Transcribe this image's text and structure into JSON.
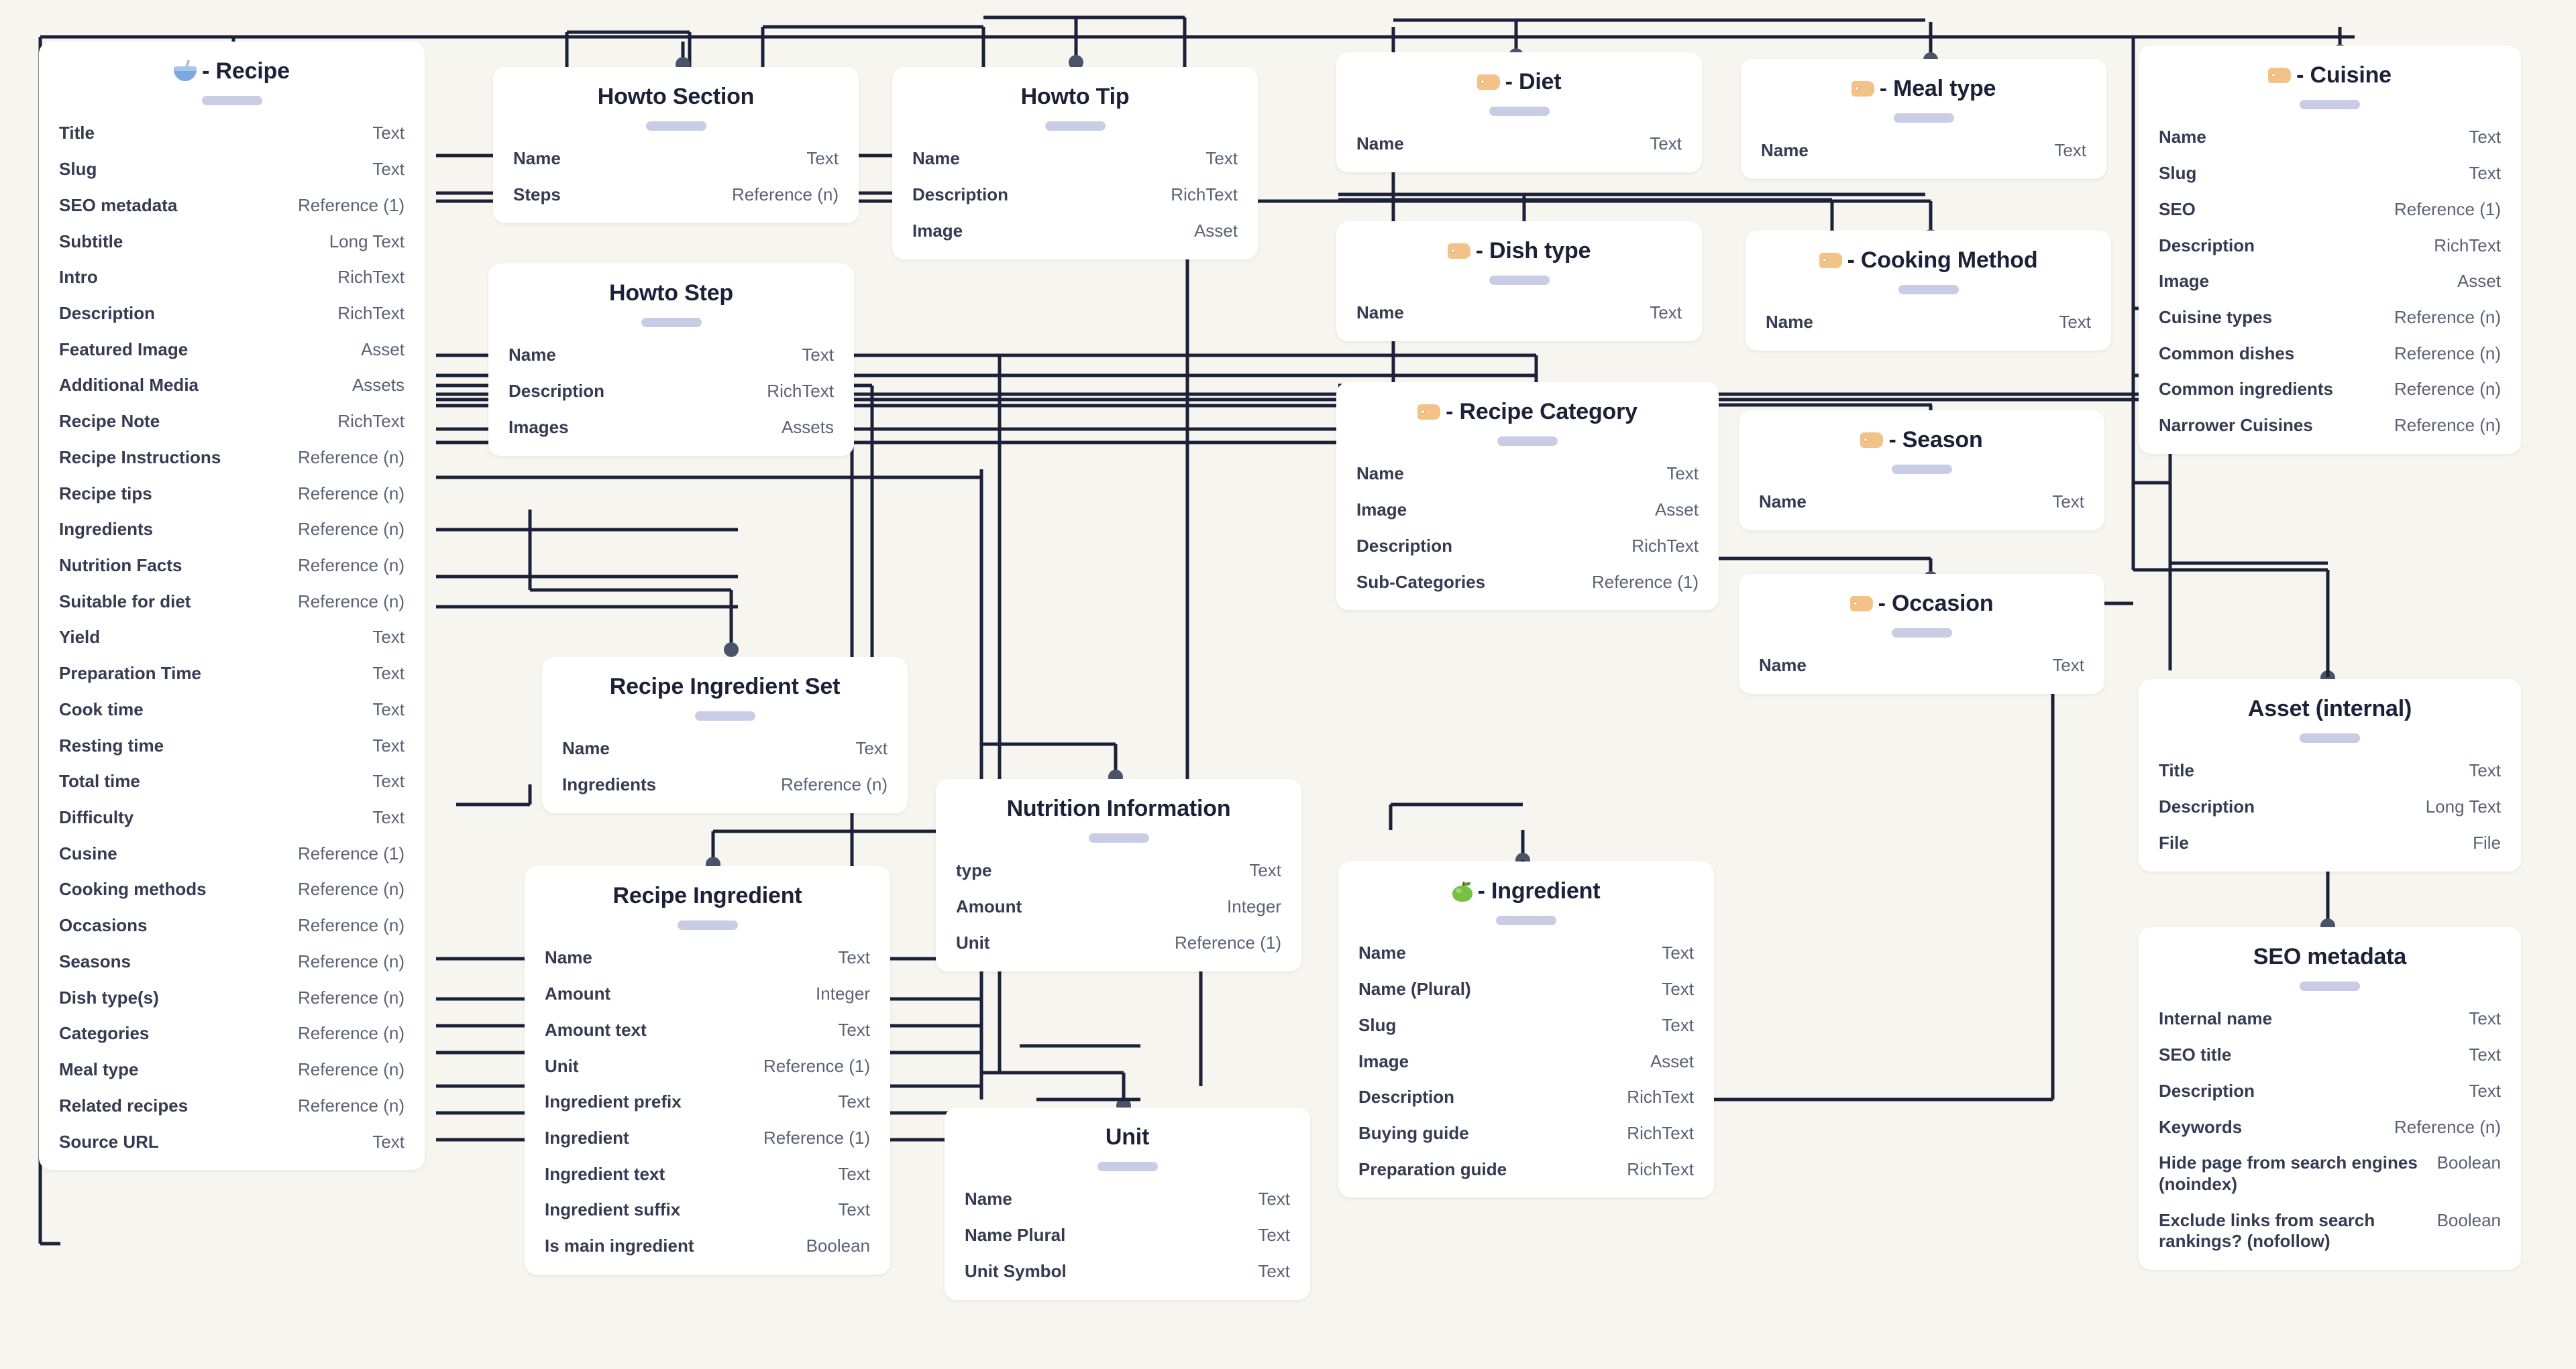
{
  "diagram": {
    "title": "Recipe content model",
    "background_color": "#f7f5ef",
    "card_color": "#ffffff",
    "line_color": "#1b2138",
    "pill_color": "#c9cce5",
    "tag_color": "#f2c288"
  },
  "entities": [
    {
      "id": "recipe",
      "emoji": "bowl-with-spoon",
      "title": "- Recipe",
      "fields": [
        {
          "name": "Title",
          "type": "Text"
        },
        {
          "name": "Slug",
          "type": "Text"
        },
        {
          "name": "SEO metadata",
          "type": "Reference (1)"
        },
        {
          "name": "Subtitle",
          "type": "Long Text"
        },
        {
          "name": "Intro",
          "type": "RichText"
        },
        {
          "name": "Description",
          "type": "RichText"
        },
        {
          "name": "Featured Image",
          "type": "Asset"
        },
        {
          "name": "Additional Media",
          "type": "Assets"
        },
        {
          "name": "Recipe Note",
          "type": "RichText"
        },
        {
          "name": "Recipe Instructions",
          "type": "Reference (n)"
        },
        {
          "name": "Recipe tips",
          "type": "Reference (n)"
        },
        {
          "name": "Ingredients",
          "type": "Reference (n)"
        },
        {
          "name": "Nutrition Facts",
          "type": "Reference (n)"
        },
        {
          "name": "Suitable for diet",
          "type": "Reference (n)"
        },
        {
          "name": "Yield",
          "type": "Text"
        },
        {
          "name": "Preparation Time",
          "type": "Text"
        },
        {
          "name": "Cook time",
          "type": "Text"
        },
        {
          "name": "Resting time",
          "type": "Text"
        },
        {
          "name": "Total time",
          "type": "Text"
        },
        {
          "name": "Difficulty",
          "type": "Text"
        },
        {
          "name": "Cusine",
          "type": "Reference (1)"
        },
        {
          "name": "Cooking methods",
          "type": "Reference (n)"
        },
        {
          "name": "Occasions",
          "type": "Reference (n)"
        },
        {
          "name": "Seasons",
          "type": "Reference (n)"
        },
        {
          "name": "Dish type(s)",
          "type": "Reference (n)"
        },
        {
          "name": "Categories",
          "type": "Reference (n)"
        },
        {
          "name": "Meal type",
          "type": "Reference (n)"
        },
        {
          "name": "Related recipes",
          "type": "Reference (n)"
        },
        {
          "name": "Source URL",
          "type": "Text"
        }
      ]
    },
    {
      "id": "howto-section",
      "emoji": "",
      "title": "Howto Section",
      "fields": [
        {
          "name": "Name",
          "type": "Text"
        },
        {
          "name": "Steps",
          "type": "Reference (n)"
        }
      ]
    },
    {
      "id": "howto-step",
      "emoji": "",
      "title": "Howto Step",
      "fields": [
        {
          "name": "Name",
          "type": "Text"
        },
        {
          "name": "Description",
          "type": "RichText"
        },
        {
          "name": "Images",
          "type": "Assets"
        }
      ]
    },
    {
      "id": "howto-tip",
      "emoji": "",
      "title": "Howto Tip",
      "fields": [
        {
          "name": "Name",
          "type": "Text"
        },
        {
          "name": "Description",
          "type": "RichText"
        },
        {
          "name": "Image",
          "type": "Asset"
        }
      ]
    },
    {
      "id": "diet",
      "emoji": "tag",
      "title": "- Diet",
      "fields": [
        {
          "name": "Name",
          "type": "Text"
        }
      ]
    },
    {
      "id": "meal-type",
      "emoji": "tag",
      "title": "- Meal type",
      "fields": [
        {
          "name": "Name",
          "type": "Text"
        }
      ]
    },
    {
      "id": "cuisine",
      "emoji": "tag",
      "title": "- Cuisine",
      "fields": [
        {
          "name": "Name",
          "type": "Text"
        },
        {
          "name": "Slug",
          "type": "Text"
        },
        {
          "name": "SEO",
          "type": "Reference (1)"
        },
        {
          "name": "Description",
          "type": "RichText"
        },
        {
          "name": "Image",
          "type": "Asset"
        },
        {
          "name": "Cuisine types",
          "type": "Reference (n)"
        },
        {
          "name": "Common dishes",
          "type": "Reference (n)"
        },
        {
          "name": "Common ingredients",
          "type": "Reference (n)"
        },
        {
          "name": "Narrower Cuisines",
          "type": "Reference (n)"
        }
      ]
    },
    {
      "id": "dish-type",
      "emoji": "tag",
      "title": "- Dish type",
      "fields": [
        {
          "name": "Name",
          "type": "Text"
        }
      ]
    },
    {
      "id": "cooking-method",
      "emoji": "tag",
      "title": "- Cooking Method",
      "fields": [
        {
          "name": "Name",
          "type": "Text"
        }
      ]
    },
    {
      "id": "recipe-category",
      "emoji": "tag",
      "title": "- Recipe Category",
      "fields": [
        {
          "name": "Name",
          "type": "Text"
        },
        {
          "name": "Image",
          "type": "Asset"
        },
        {
          "name": "Description",
          "type": "RichText"
        },
        {
          "name": "Sub-Categories",
          "type": "Reference (1)"
        }
      ]
    },
    {
      "id": "season",
      "emoji": "tag",
      "title": "- Season",
      "fields": [
        {
          "name": "Name",
          "type": "Text"
        }
      ]
    },
    {
      "id": "occasion",
      "emoji": "tag",
      "title": "- Occasion",
      "fields": [
        {
          "name": "Name",
          "type": "Text"
        }
      ]
    },
    {
      "id": "recipe-ingredient-set",
      "emoji": "",
      "title": "Recipe Ingredient Set",
      "fields": [
        {
          "name": "Name",
          "type": "Text"
        },
        {
          "name": "Ingredients",
          "type": "Reference (n)"
        }
      ]
    },
    {
      "id": "recipe-ingredient",
      "emoji": "",
      "title": "Recipe Ingredient",
      "fields": [
        {
          "name": "Name",
          "type": "Text"
        },
        {
          "name": "Amount",
          "type": "Integer"
        },
        {
          "name": "Amount text",
          "type": "Text"
        },
        {
          "name": "Unit",
          "type": "Reference (1)"
        },
        {
          "name": "Ingredient prefix",
          "type": "Text"
        },
        {
          "name": "Ingredient",
          "type": "Reference (1)"
        },
        {
          "name": "Ingredient text",
          "type": "Text"
        },
        {
          "name": "Ingredient suffix",
          "type": "Text"
        },
        {
          "name": "Is main ingredient",
          "type": "Boolean"
        }
      ]
    },
    {
      "id": "nutrition-information",
      "emoji": "",
      "title": "Nutrition Information",
      "fields": [
        {
          "name": "type",
          "type": "Text"
        },
        {
          "name": "Amount",
          "type": "Integer"
        },
        {
          "name": "Unit",
          "type": "Reference (1)"
        }
      ]
    },
    {
      "id": "unit",
      "emoji": "",
      "title": "Unit",
      "fields": [
        {
          "name": "Name",
          "type": "Text"
        },
        {
          "name": "Name Plural",
          "type": "Text"
        },
        {
          "name": "Unit Symbol",
          "type": "Text"
        }
      ]
    },
    {
      "id": "ingredient",
      "emoji": "green-apple",
      "title": "- Ingredient",
      "fields": [
        {
          "name": "Name",
          "type": "Text"
        },
        {
          "name": "Name (Plural)",
          "type": "Text"
        },
        {
          "name": "Slug",
          "type": "Text"
        },
        {
          "name": "Image",
          "type": "Asset"
        },
        {
          "name": "Description",
          "type": "RichText"
        },
        {
          "name": "Buying guide",
          "type": "RichText"
        },
        {
          "name": "Preparation guide",
          "type": "RichText"
        }
      ]
    },
    {
      "id": "asset-internal",
      "emoji": "",
      "title": "Asset (internal)",
      "fields": [
        {
          "name": "Title",
          "type": "Text"
        },
        {
          "name": "Description",
          "type": "Long Text"
        },
        {
          "name": "File",
          "type": "File"
        }
      ]
    },
    {
      "id": "seo-metadata",
      "emoji": "",
      "title": "SEO metadata",
      "fields": [
        {
          "name": "Internal name",
          "type": "Text"
        },
        {
          "name": "SEO title",
          "type": "Text"
        },
        {
          "name": "Description",
          "type": "Text"
        },
        {
          "name": "Keywords",
          "type": "Reference (n)"
        },
        {
          "name": "Hide page from search engines (noindex)",
          "type": "Boolean"
        },
        {
          "name": "Exclude links from search rankings? (nofollow)",
          "type": "Boolean"
        }
      ]
    }
  ]
}
